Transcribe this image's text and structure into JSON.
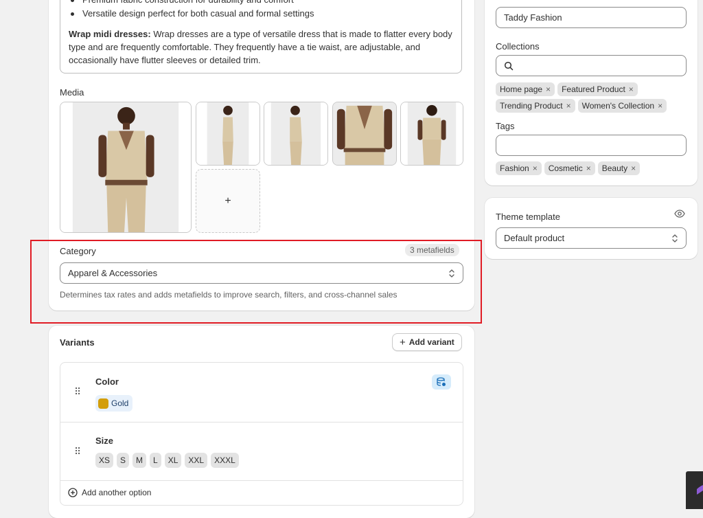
{
  "description": {
    "bullets": [
      "Premium fabric construction for durability and comfort",
      "Versatile design perfect for both casual and formal settings"
    ],
    "paragraph_bold": "Wrap midi dresses:",
    "paragraph_text": " Wrap dresses are a type of versatile dress that is made to flatter every body type and are frequently comfortable. They frequently have a tie waist, are adjustable, and occasionally have flutter sleeves or detailed trim."
  },
  "media": {
    "label": "Media",
    "add_symbol": "+"
  },
  "category": {
    "label": "Category",
    "badge": "3 metafields",
    "value": "Apparel & Accessories",
    "help": "Determines tax rates and adds metafields to improve search, filters, and cross-channel sales"
  },
  "variants": {
    "title": "Variants",
    "add_variant": "Add variant",
    "options": [
      {
        "name": "Color",
        "values": [
          "Gold"
        ],
        "swatch": "#d39e0b"
      },
      {
        "name": "Size",
        "values": [
          "XS",
          "S",
          "M",
          "L",
          "XL",
          "XXL",
          "XXXL"
        ]
      }
    ],
    "add_option": "Add another option"
  },
  "organization": {
    "vendor_value": "Taddy Fashion",
    "collections_label": "Collections",
    "collections_search_placeholder": "",
    "collections_tags_row1": [
      "Home page",
      "Featured Product"
    ],
    "collections_tags_row2": [
      "Trending Product",
      "Women's Collection"
    ],
    "tags_label": "Tags",
    "tags_input_value": "",
    "tags": [
      "Fashion",
      "Cosmetic",
      "Beauty"
    ]
  },
  "theme": {
    "label": "Theme template",
    "value": "Default product"
  },
  "icons": {
    "remove": "×",
    "drag": "⠿",
    "add_plus": "+"
  },
  "colors": {
    "highlight": "#e01b24",
    "swatch_gold": "#d39e0b"
  }
}
